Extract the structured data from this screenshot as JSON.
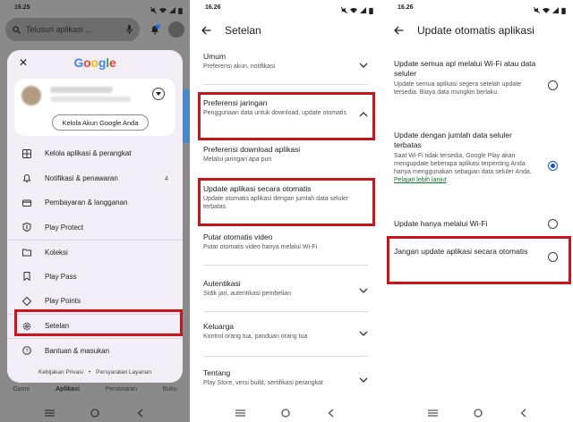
{
  "panel1": {
    "time": "16.25",
    "search_placeholder": "Telusuri aplikasi ...",
    "notif_badge": "4",
    "google_logo": "Google",
    "logo_colors": [
      "#4285F4",
      "#EA4335",
      "#FBBC05",
      "#4285F4",
      "#34A853",
      "#EA4335"
    ],
    "manage_account": "Kelola Akun Google Anda",
    "menu": [
      {
        "icon": "apps-grid-icon",
        "label": "Kelola aplikasi & perangkat",
        "count": ""
      },
      {
        "icon": "bell-icon",
        "label": "Notifikasi & penawaran",
        "count": "4"
      },
      {
        "icon": "credit-card-icon",
        "label": "Pembayaran & langganan",
        "count": ""
      },
      {
        "icon": "shield-icon",
        "label": "Play Protect",
        "count": ""
      },
      {
        "icon": "folder-icon",
        "label": "Koleksi",
        "count": ""
      },
      {
        "icon": "bookmark-icon",
        "label": "Play Pass",
        "count": ""
      },
      {
        "icon": "diamond-icon",
        "label": "Play Points",
        "count": ""
      },
      {
        "icon": "gear-icon",
        "label": "Setelan",
        "count": ""
      },
      {
        "icon": "help-icon",
        "label": "Bantuan & masukan",
        "count": ""
      }
    ],
    "footer": {
      "privacy": "Kebijakan Privasi",
      "dot": "•",
      "terms": "Persyaratan Layanan"
    },
    "bottom_tabs": [
      "Game",
      "Aplikasi",
      "Penawaran",
      "Buku"
    ],
    "highlight_color": "#c8141a"
  },
  "panel2": {
    "time": "16.26",
    "title": "Setelan",
    "items": [
      {
        "title": "Umum",
        "desc": "Preferensi akun, notifikasi",
        "chevron": "down"
      },
      {
        "title": "Preferensi jaringan",
        "desc": "Penggunaan data untuk download, update otomatis",
        "chevron": "up"
      },
      {
        "title": "Preferensi download aplikasi",
        "desc": "Melalui jaringan apa pun",
        "chevron": ""
      },
      {
        "title": "Update aplikasi secara otomatis",
        "desc": "Update otomatis aplikasi dengan jumlah data seluler terbatas",
        "chevron": ""
      },
      {
        "title": "Putar otomatis video",
        "desc": "Putar otomatis video hanya melalui Wi-Fi",
        "chevron": ""
      },
      {
        "title": "Autentikasi",
        "desc": "Sidik jari, autentikasi pembelian",
        "chevron": "down"
      },
      {
        "title": "Keluarga",
        "desc": "Kontrol orang tua, panduan orang tua",
        "chevron": "down"
      },
      {
        "title": "Tentang",
        "desc": "Play Store, versi build, sertifikasi perangkat",
        "chevron": "down"
      }
    ]
  },
  "panel3": {
    "time": "16.26",
    "title": "Update otomatis aplikasi",
    "options": [
      {
        "title": "Update semua apl melalui Wi-Fi atau data seluler",
        "desc": "Update semua aplikasi segera setelah update tersedia. Biaya data mungkin berlaku.",
        "link": "",
        "selected": false
      },
      {
        "title": "Update dengan jumlah data seluler terbatas",
        "desc": "Saat Wi-Fi tidak tersedia, Google Play akan mengupdate beberapa aplikasi terpenting Anda hanya menggunakan sebagian data seluler Anda.",
        "link": "Pelajari lebih lanjut",
        "selected": true
      },
      {
        "title": "Update hanya melalui Wi-Fi",
        "desc": "",
        "link": "",
        "selected": false
      },
      {
        "title": "Jangan update aplikasi secara otomatis",
        "desc": "",
        "link": "",
        "selected": false
      }
    ],
    "selected_color": "#0b57d0"
  }
}
